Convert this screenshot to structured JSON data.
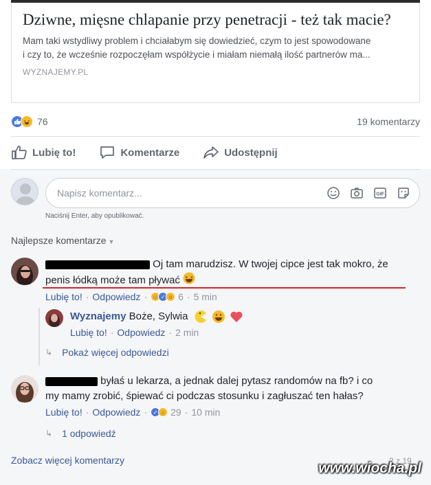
{
  "link_card": {
    "title": "Dziwne, mięsne chlapanie przy penetracji - też tak macie?",
    "description_line1": "Mam taki wstydliwy problem i chciałabym się dowiedzieć, czym to jest spowodowane",
    "description_line2": "i czy to, że wcześnie rozpoczęłam współżycie i miałam niemałą ilość partnerów ma...",
    "domain": "WYZNAJEMY.PL"
  },
  "post_stats": {
    "reaction_count": "76",
    "comment_count": "19 komentarzy"
  },
  "actions": {
    "like": "Lubię to!",
    "comment": "Komentarze",
    "share": "Udostępnij"
  },
  "composer": {
    "placeholder": "Napisz komentarz...",
    "hint": "Naciśnij Enter, aby opublikować."
  },
  "sort_label": "Najlepsze komentarze",
  "comments": [
    {
      "text_line1": "Oj tam marudzisz. W twojej cipce jest tak mokro, że",
      "text_line2": "penis łódką może tam pływać",
      "like": "Lubię to!",
      "reply": "Odpowiedz",
      "reactions": "6",
      "time": "5 min"
    },
    {
      "text_line1": "byłaś u lekarza, a jednak dalej pytasz randomów na fb? i co",
      "text_line2": "my mamy zrobić, śpiewać ci podczas stosunku i zagłuszać ten hałas?",
      "like": "Lubię to!",
      "reply": "Odpowiedz",
      "reactions": "29",
      "time": "10 min"
    }
  ],
  "reply": {
    "author": "Wyznajemy",
    "text": "Boże, Sylwia",
    "like": "Lubię to!",
    "reply": "Odpowiedz",
    "time": "2 min"
  },
  "more_replies": "Pokaż więcej odpowiedzi",
  "one_reply": "1 odpowiedź",
  "see_more": "Zobacz więcej komentarzy",
  "pager": "2 z 19",
  "watermark": "www.wiocha.pl",
  "colors": {
    "link_blue": "#385898",
    "like_blue": "#4a79e4",
    "haha_yellow": "#f7b928",
    "underline_red": "#d8232a"
  }
}
